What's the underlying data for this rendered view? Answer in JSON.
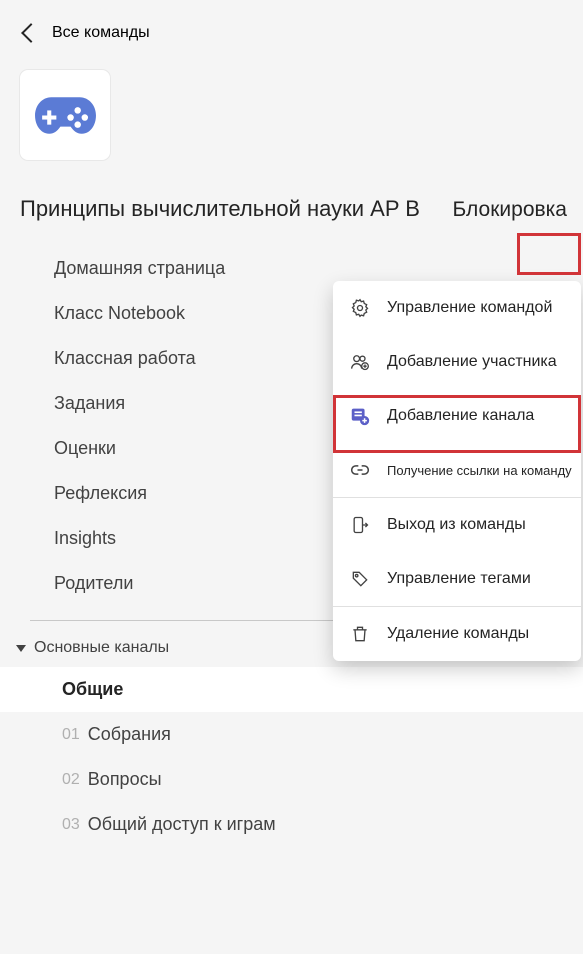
{
  "back": {
    "label": "Все команды"
  },
  "team": {
    "title": "Принципы вычислительной науки AP B",
    "lock_label": "Блокировка",
    "avatar_icon": "gamepad-icon"
  },
  "nav": {
    "items": [
      {
        "label": "Домашняя страница"
      },
      {
        "label": "Класс Notebook"
      },
      {
        "label": "Классная работа"
      },
      {
        "label": "Задания"
      },
      {
        "label": "Оценки"
      },
      {
        "label": "Рефлексия"
      },
      {
        "label": "Insights"
      },
      {
        "label": "Родители"
      }
    ]
  },
  "channels": {
    "section_label": "Основные каналы",
    "items": [
      {
        "prefix": "",
        "label": "Общие",
        "active": true
      },
      {
        "prefix": "01",
        "label": "Собрания",
        "active": false
      },
      {
        "prefix": "02",
        "label": "Вопросы",
        "active": false
      },
      {
        "prefix": "03",
        "label": "Общий доступ к играм",
        "active": false
      }
    ]
  },
  "context_menu": {
    "items": [
      {
        "icon": "gear-icon",
        "label": "Управление командой"
      },
      {
        "icon": "add-member-icon",
        "label": "Добавление участника"
      },
      {
        "icon": "add-channel-icon",
        "label": "Добавление канала"
      },
      {
        "icon": "link-icon",
        "label": "Получение ссылки на команду",
        "small": true
      },
      {
        "icon": "leave-icon",
        "label": "Выход из команды"
      },
      {
        "icon": "tag-icon",
        "label": "Управление тегами"
      },
      {
        "icon": "trash-icon",
        "label": "Удаление команды"
      }
    ]
  }
}
